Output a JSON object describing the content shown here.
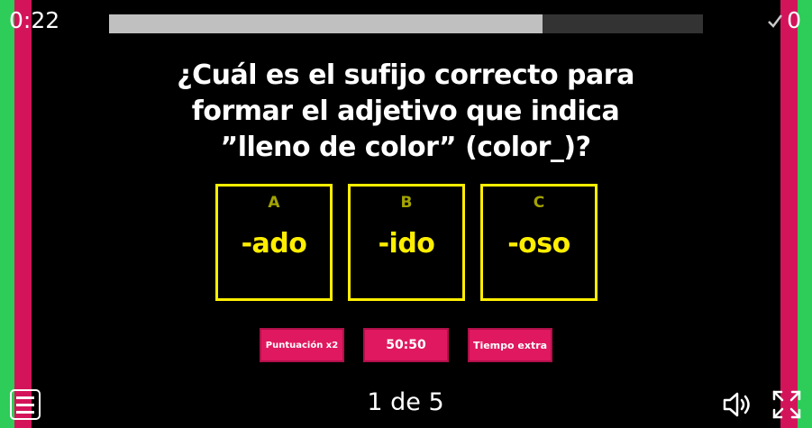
{
  "header": {
    "timer": "0:22",
    "progress_fraction": 0.73,
    "score": "0"
  },
  "question": {
    "line1": "¿Cuál es el sufijo correcto para",
    "line2": "formar el adjetivo que indica",
    "line3": "”lleno de color” (color_)?"
  },
  "answers": [
    {
      "letter": "A",
      "text": "-ado"
    },
    {
      "letter": "B",
      "text": "-ido"
    },
    {
      "letter": "C",
      "text": "-oso"
    }
  ],
  "powerups": {
    "double_score": "Puntuación x2",
    "fifty_fifty": "50:50",
    "extra_time": "Tiempo extra"
  },
  "footer": {
    "pager": "1 de 5"
  },
  "colors": {
    "green": "#2ecc59",
    "pink": "#d4145a",
    "answer_yellow": "#ffee00",
    "powerup": "#e0185f"
  },
  "icons": [
    "menu-icon",
    "checkmark-icon",
    "speaker-icon",
    "fullscreen-icon"
  ]
}
